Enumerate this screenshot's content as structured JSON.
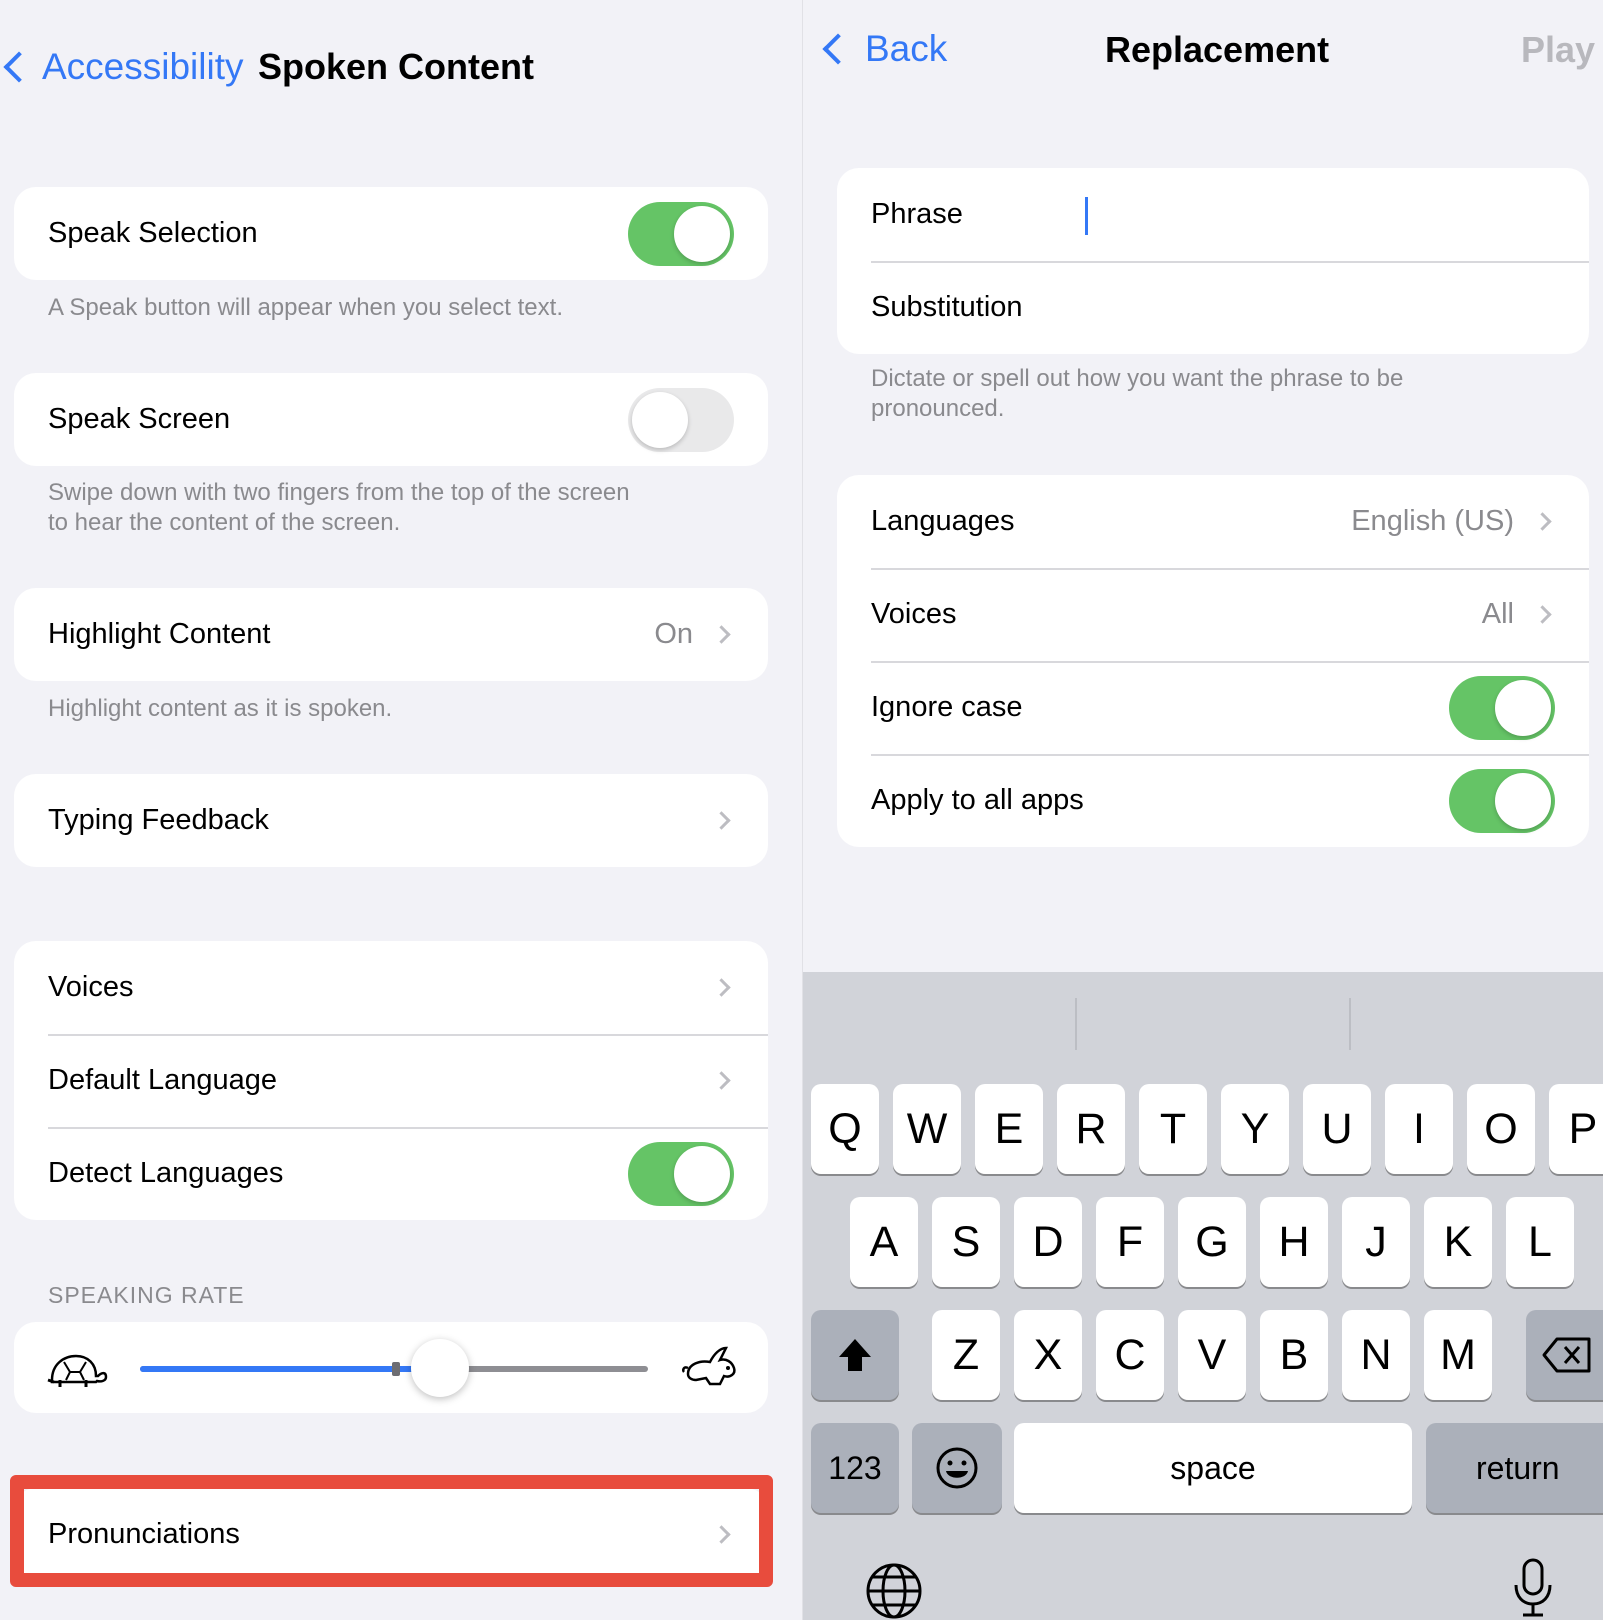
{
  "left": {
    "back_label": "Accessibility",
    "title": "Spoken Content",
    "speak_selection": {
      "label": "Speak Selection",
      "on": true,
      "footer": "A Speak button will appear when you select text."
    },
    "speak_screen": {
      "label": "Speak Screen",
      "on": false,
      "footer_line1": "Swipe down with two fingers from the top of the screen",
      "footer_line2": "to hear the content of the screen."
    },
    "highlight_content": {
      "label": "Highlight Content",
      "value": "On",
      "footer": "Highlight content as it is spoken."
    },
    "typing_feedback": {
      "label": "Typing Feedback"
    },
    "voices": {
      "label": "Voices"
    },
    "default_language": {
      "label": "Default Language"
    },
    "detect_languages": {
      "label": "Detect Languages",
      "on": true
    },
    "speaking_rate": {
      "header": "SPEAKING RATE",
      "value_fraction": 0.59,
      "slow_icon": "turtle-icon",
      "fast_icon": "rabbit-icon"
    },
    "pronunciations": {
      "label": "Pronunciations"
    }
  },
  "right": {
    "back_label": "Back",
    "title": "Replacement",
    "play_label": "Play",
    "phrase": {
      "label": "Phrase",
      "value": ""
    },
    "substitution": {
      "label": "Substitution",
      "value": ""
    },
    "footer_line1": "Dictate or spell out how you want the phrase to be",
    "footer_line2": "pronounced.",
    "languages": {
      "label": "Languages",
      "value": "English (US)"
    },
    "voices": {
      "label": "Voices",
      "value": "All"
    },
    "ignore_case": {
      "label": "Ignore case",
      "on": true
    },
    "apply_all": {
      "label": "Apply to all apps",
      "on": true
    }
  },
  "keyboard": {
    "row1": [
      "Q",
      "W",
      "E",
      "R",
      "T",
      "Y",
      "U",
      "I",
      "O",
      "P"
    ],
    "row2": [
      "A",
      "S",
      "D",
      "F",
      "G",
      "H",
      "J",
      "K",
      "L"
    ],
    "row3": [
      "Z",
      "X",
      "C",
      "V",
      "B",
      "N",
      "M"
    ],
    "numbers_label": "123",
    "space_label": "space",
    "return_label": "return",
    "shift_icon": "shift-icon",
    "delete_icon": "delete-icon",
    "emoji_icon": "emoji-icon",
    "globe_icon": "globe-icon",
    "mic_icon": "microphone-icon"
  },
  "colors": {
    "accent": "#3478f6",
    "toggle_on": "#65c466",
    "highlight": "#e84c3d",
    "background": "#f2f2f7"
  }
}
